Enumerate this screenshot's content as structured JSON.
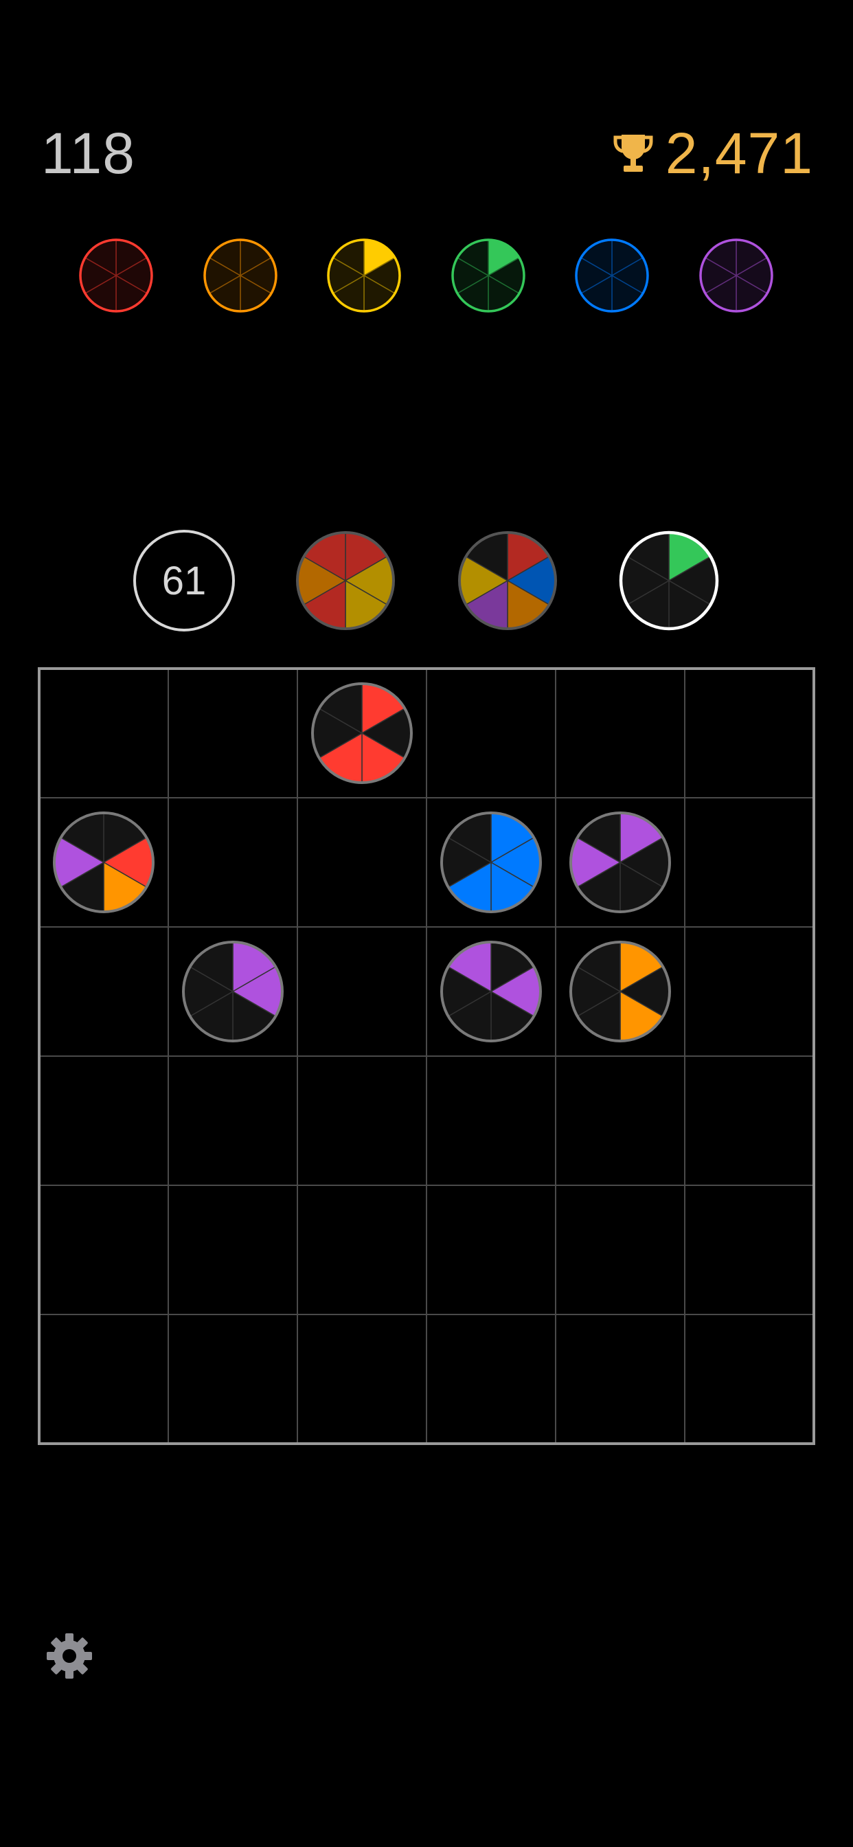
{
  "header": {
    "score": "118",
    "best_score": "2,471",
    "trophy_icon": "trophy-icon",
    "trophy_color": "#f0b54a"
  },
  "color_progress": [
    {
      "color": "red",
      "hex": "#ff3b30",
      "filled": [
        false,
        false,
        false,
        false,
        false,
        false
      ]
    },
    {
      "color": "orange",
      "hex": "#ff9500",
      "filled": [
        false,
        false,
        false,
        false,
        false,
        false
      ]
    },
    {
      "color": "yellow",
      "hex": "#ffcc00",
      "filled": [
        true,
        false,
        false,
        false,
        false,
        false
      ]
    },
    {
      "color": "green",
      "hex": "#34c759",
      "filled": [
        true,
        false,
        false,
        false,
        false,
        false
      ]
    },
    {
      "color": "blue",
      "hex": "#007aff",
      "filled": [
        false,
        false,
        false,
        false,
        false,
        false
      ]
    },
    {
      "color": "purple",
      "hex": "#af52de",
      "filled": [
        false,
        false,
        false,
        false,
        false,
        false
      ]
    }
  ],
  "queue": {
    "remaining_count": "61",
    "pieces": [
      {
        "slices": [
          "#ff3b30",
          "#ffcc00",
          "#ffcc00",
          "#ff3b30",
          "#ff9500",
          "#ff3b30"
        ],
        "dimmed": true,
        "selected": false,
        "ring_color": "#555555"
      },
      {
        "slices": [
          "#ff3b30",
          "#007aff",
          "#ff9500",
          "#af52de",
          "#ffcc00",
          null
        ],
        "dimmed": true,
        "selected": false,
        "ring_color": "#555555"
      },
      {
        "slices": [
          "#34c759",
          null,
          null,
          null,
          null,
          null
        ],
        "dimmed": false,
        "selected": true,
        "ring_color": "#ffffff"
      }
    ]
  },
  "board": {
    "rows": 6,
    "cols": 6,
    "pieces": [
      {
        "row": 0,
        "col": 2,
        "slices": [
          "#ff3b30",
          null,
          "#ff3b30",
          "#ff3b30",
          null,
          null
        ]
      },
      {
        "row": 1,
        "col": 0,
        "slices": [
          null,
          "#ff3b30",
          "#ff9500",
          null,
          "#af52de",
          null
        ]
      },
      {
        "row": 1,
        "col": 3,
        "slices": [
          "#007aff",
          "#007aff",
          "#007aff",
          "#007aff",
          null,
          null
        ]
      },
      {
        "row": 1,
        "col": 4,
        "slices": [
          "#af52de",
          null,
          null,
          null,
          "#af52de",
          null
        ]
      },
      {
        "row": 2,
        "col": 1,
        "slices": [
          "#af52de",
          "#af52de",
          null,
          null,
          null,
          null
        ]
      },
      {
        "row": 2,
        "col": 3,
        "slices": [
          null,
          "#af52de",
          null,
          null,
          null,
          "#af52de"
        ]
      },
      {
        "row": 2,
        "col": 4,
        "slices": [
          "#ff9500",
          null,
          "#ff9500",
          null,
          null,
          null
        ]
      }
    ]
  },
  "footer": {
    "settings_icon": "gear-icon"
  }
}
